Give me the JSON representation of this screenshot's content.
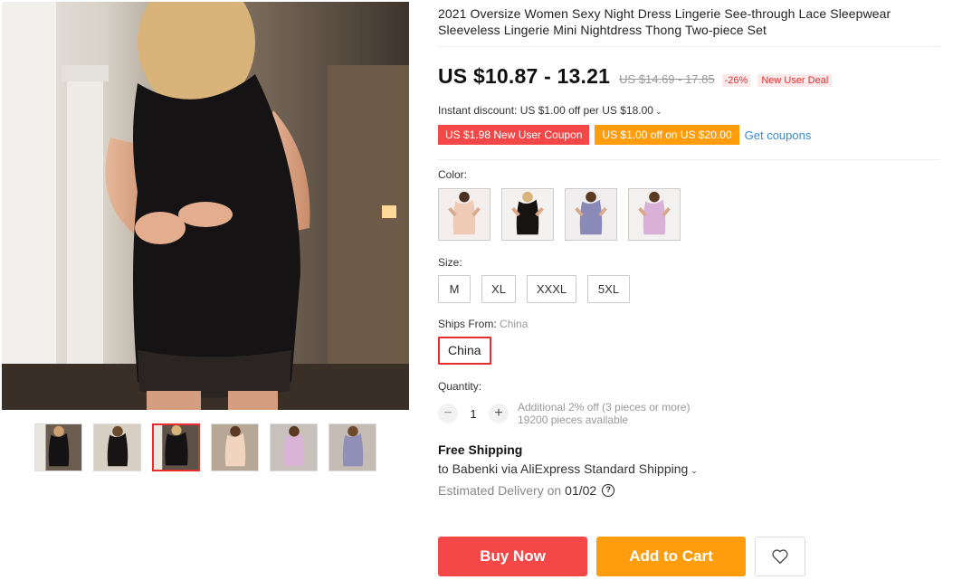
{
  "product": {
    "title": "2021 Oversize Women Sexy Night Dress Lingerie See-through Lace Sleepwear Sleeveless Lingerie Mini Nightdress Thong Two-piece Set"
  },
  "price": {
    "current": "US $10.87 - 13.21",
    "original": "US $14.69 - 17.85",
    "discount": "-26%",
    "deal_badge": "New User Deal"
  },
  "instant_discount": "Instant discount: US $1.00 off per US $18.00",
  "coupons": {
    "items": [
      "US $1.98 New User Coupon",
      "US $1.00 off on US $20.00"
    ],
    "get_label": "Get coupons"
  },
  "color": {
    "label": "Color:",
    "options": [
      "nude",
      "black",
      "purple",
      "pink"
    ]
  },
  "size": {
    "label": "Size:",
    "options": [
      "M",
      "XL",
      "XXXL",
      "5XL"
    ]
  },
  "ships_from": {
    "label": "Ships From:",
    "selected": "China",
    "options": [
      "China"
    ]
  },
  "quantity": {
    "label": "Quantity:",
    "value": "1",
    "minus": "−",
    "plus": "+",
    "bulk_note": "Additional 2% off (3 pieces or more)",
    "available": "19200 pieces available"
  },
  "shipping": {
    "title": "Free Shipping",
    "to": "to Babenki via AliExpress Standard Shipping",
    "delivery_label": "Estimated Delivery on",
    "delivery_date": "01/02"
  },
  "actions": {
    "buy": "Buy Now",
    "cart": "Add to Cart"
  },
  "colors": {
    "accent": "#f44848",
    "orange": "#ff9d0d",
    "link": "#3a8bd6"
  }
}
